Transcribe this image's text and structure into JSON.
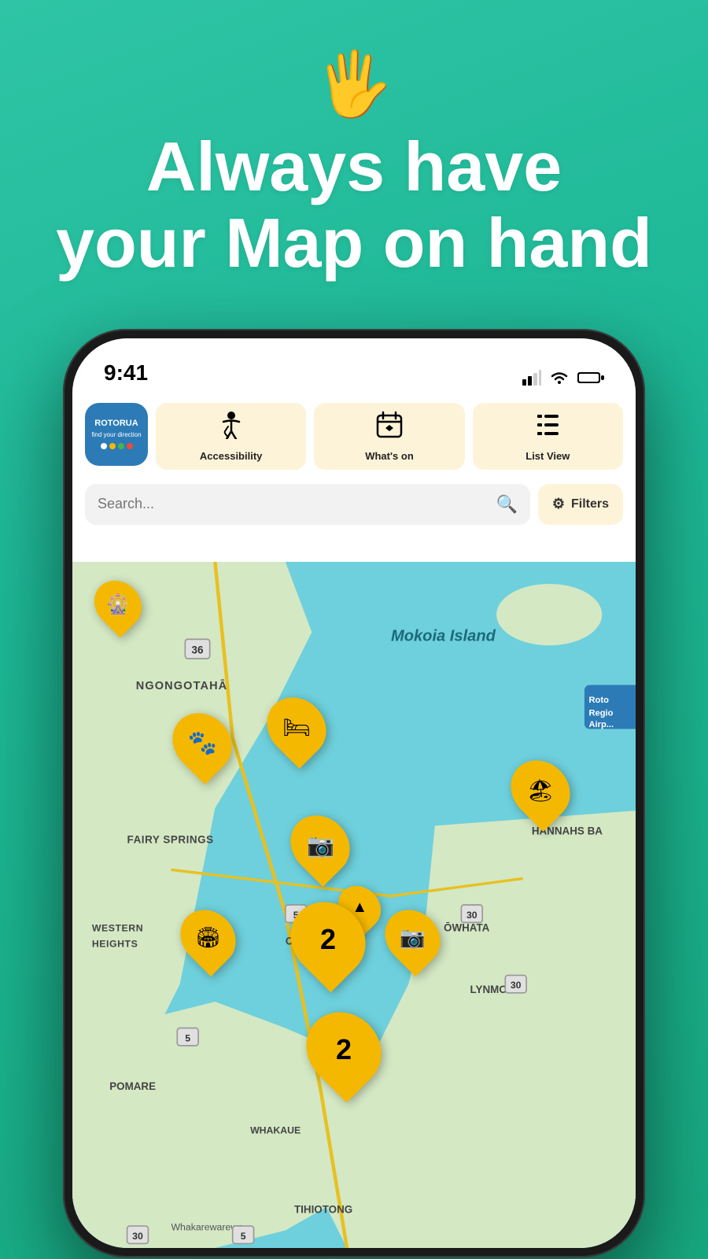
{
  "hero": {
    "emoji": "🖐️",
    "title_line1": "Always have",
    "title_line2": "your Map on hand"
  },
  "status_bar": {
    "time": "9:41",
    "signal": "▌▌▌",
    "wifi": "wifi",
    "battery": "battery"
  },
  "logo": {
    "text": "ROTORUA",
    "subtitle": "find your direction"
  },
  "quick_buttons": [
    {
      "id": "accessibility",
      "icon": "♿",
      "label": "Accessibility"
    },
    {
      "id": "whats-on",
      "icon": "📅",
      "label": "What's on"
    },
    {
      "id": "list-view",
      "icon": "☰",
      "label": "List View"
    }
  ],
  "search": {
    "placeholder": "Search...",
    "filters_label": "Filters"
  },
  "map": {
    "labels": [
      {
        "text": "Mokoia Island",
        "style": "italic"
      },
      {
        "text": "NGONGOTAHĀ",
        "style": "bold"
      },
      {
        "text": "FAIRY SPRINGS",
        "style": "bold"
      },
      {
        "text": "WESTERN HEIGHTS",
        "style": "bold"
      },
      {
        "text": "OHINEMURI",
        "style": "bold"
      },
      {
        "text": "POMARE",
        "style": "bold"
      },
      {
        "text": "WHAKAUE",
        "style": "bold"
      },
      {
        "text": "TIHIOTONG",
        "style": "bold"
      },
      {
        "text": "LYNMORE",
        "style": "bold"
      },
      {
        "text": "ŌWHATA",
        "style": "bold"
      },
      {
        "text": "HANNAHS BA",
        "style": "bold"
      },
      {
        "text": "Whakarewarewa",
        "style": "normal"
      },
      {
        "text": "Roto Regio Airp",
        "style": "bold"
      }
    ],
    "pins": [
      {
        "icon": "🎡",
        "size": "normal",
        "label": ""
      },
      {
        "icon": "🐾",
        "size": "normal",
        "label": ""
      },
      {
        "icon": "🛏️",
        "size": "normal",
        "label": ""
      },
      {
        "icon": "🏖️",
        "size": "normal",
        "label": ""
      },
      {
        "icon": "📷",
        "size": "normal",
        "label": ""
      },
      {
        "icon": "📷",
        "size": "normal",
        "label": ""
      },
      {
        "icon": "⭕",
        "size": "normal",
        "label": ""
      },
      {
        "icon": "▲",
        "size": "normal",
        "label": ""
      },
      {
        "count": "2",
        "size": "large",
        "label": "cluster-2"
      },
      {
        "count": "2",
        "size": "large",
        "label": "cluster-2-bottom"
      }
    ]
  }
}
